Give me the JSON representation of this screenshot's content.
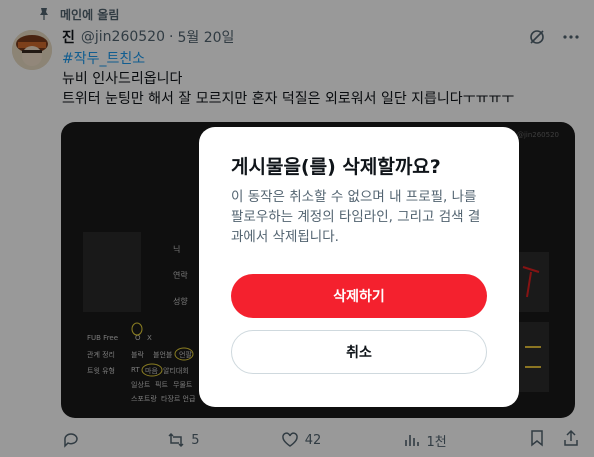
{
  "pinned": {
    "label": "메인에 올림"
  },
  "author": {
    "name": "진",
    "handle": "@jin260520",
    "separator": "·",
    "date": "5월 20일"
  },
  "post": {
    "hashtag": "#작두_트친소",
    "line1": "뉴비 인사드리옵니다",
    "line2": "트위터 눈팅만 해서 잘 모르지만 혼자 덕질은 외로워서 일단 지릅니다ㅜㅠㅠㅜ"
  },
  "media": {
    "watermark": "작두 · @jin260520",
    "rows": [
      {
        "label": "FUB Free",
        "values": [
          "O",
          "X"
        ]
      },
      {
        "label": "관계 정리",
        "values": [
          "블락",
          "블언블",
          "언팔"
        ]
      },
      {
        "label": "트윗 유형",
        "values": [
          "RT",
          "마음",
          "알티대회"
        ]
      }
    ],
    "extra_line1": [
      "일상트",
      "픽트",
      "무물트"
    ],
    "extra_line2": [
      "스포트랑",
      "타장르 언급"
    ],
    "fields": [
      "닉",
      "연락",
      "성향"
    ]
  },
  "actions": {
    "reply": "",
    "retweet": "5",
    "like": "42",
    "views": "1천"
  },
  "dialog": {
    "title": "게시물을(를) 삭제할까요?",
    "body": "이 동작은 취소할 수 없으며 내 프로필, 나를 팔로우하는 계정의 타임라인, 그리고 검색 결과에서 삭제됩니다.",
    "confirm_label": "삭제하기",
    "cancel_label": "취소"
  },
  "colors": {
    "danger": "#f4212e",
    "link": "#1d9bf0",
    "muted": "#536471",
    "highlight": "#e8d33a"
  }
}
